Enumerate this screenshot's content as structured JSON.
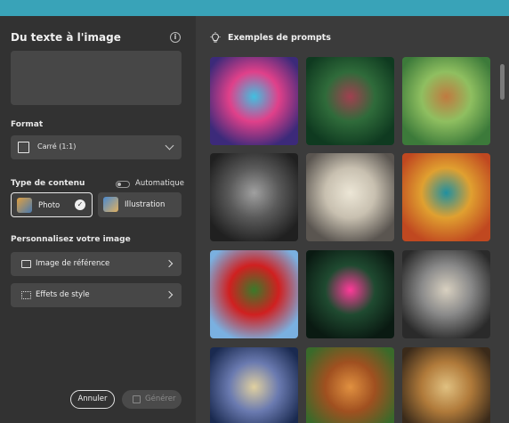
{
  "left_panel": {
    "title": "Du texte à l'image",
    "format_label": "Format",
    "format_value": "Carré (1:1)",
    "content_type_label": "Type de contenu",
    "auto_label": "Automatique",
    "content_types": [
      "Photo",
      "Illustration"
    ],
    "customize_label": "Personnalisez votre image",
    "reference_label": "Image de référence",
    "style_effects_label": "Effets de style",
    "cancel_label": "Annuler",
    "generate_label": "Générer"
  },
  "right_panel": {
    "title": "Exemples de prompts",
    "tiles": [
      {
        "name": "tile-neon-dog",
        "colors": [
          "#3c2a7a",
          "#e0408a",
          "#40c0e0"
        ]
      },
      {
        "name": "tile-jungle-statue",
        "colors": [
          "#0f3a20",
          "#2f6b3a",
          "#a04050"
        ]
      },
      {
        "name": "tile-girl-turtle",
        "colors": [
          "#3c7a3a",
          "#8fbf60",
          "#c07a40"
        ]
      },
      {
        "name": "tile-marble-table",
        "colors": [
          "#202020",
          "#5a5a5a",
          "#a0a0a0"
        ]
      },
      {
        "name": "tile-bulldog-king",
        "colors": [
          "#5a5550",
          "#c8c0b0",
          "#ece6d6"
        ]
      },
      {
        "name": "tile-dragon",
        "colors": [
          "#c04820",
          "#e0a030",
          "#2090a0"
        ]
      },
      {
        "name": "tile-tulip-house",
        "colors": [
          "#7ab0e0",
          "#d02020",
          "#3a7a2a"
        ]
      },
      {
        "name": "tile-neon-rose",
        "colors": [
          "#0a1a12",
          "#1f4a30",
          "#ff3a9a"
        ]
      },
      {
        "name": "tile-building-sketch",
        "colors": [
          "#2a2a2a",
          "#8a8a8a",
          "#d8d0c0"
        ]
      },
      {
        "name": "tile-swirl-night",
        "colors": [
          "#1a2a50",
          "#6a7ab0",
          "#e0d0a0"
        ]
      },
      {
        "name": "tile-orangutan",
        "colors": [
          "#3a6a2a",
          "#a05020",
          "#e09040"
        ]
      },
      {
        "name": "tile-steampunk-ship",
        "colors": [
          "#3a2a1a",
          "#b07a3a",
          "#e0c080"
        ]
      }
    ]
  }
}
